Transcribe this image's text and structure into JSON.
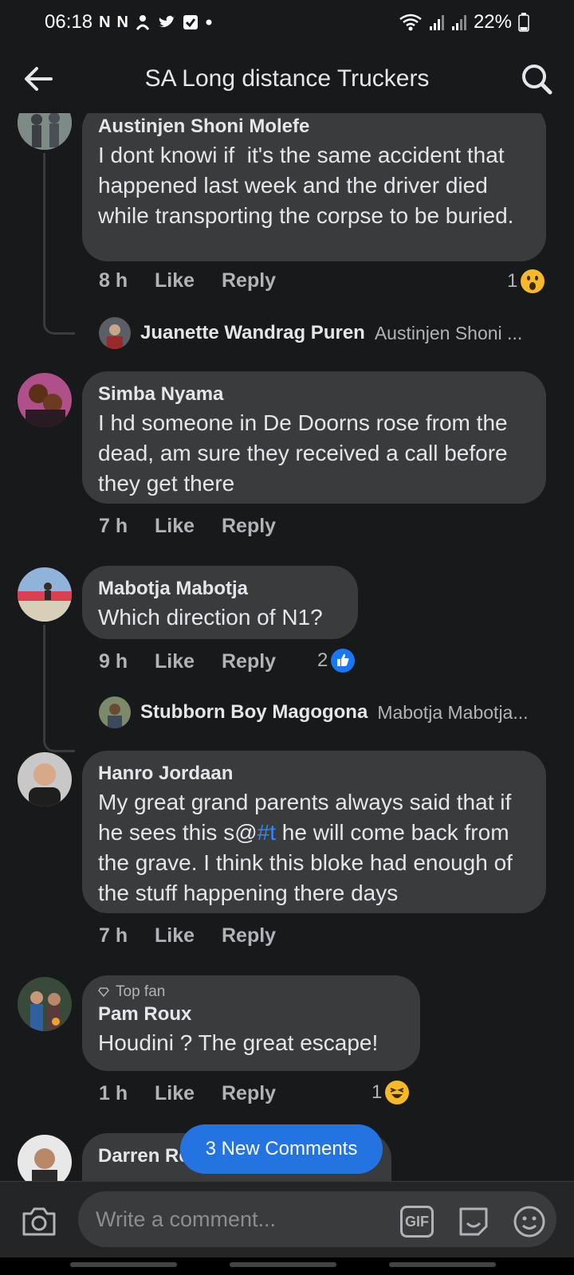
{
  "status_bar": {
    "time": "06:18",
    "battery": "22%",
    "notif_icons": [
      "N",
      "N"
    ]
  },
  "header": {
    "title": "SA Long distance Truckers"
  },
  "comments": [
    {
      "author": "Austinjen Shoni Molefe",
      "text": "I dont knowi if  it's the same accident that happened last week and the driver died while transporting the corpse to be buried.",
      "time": "8 h",
      "like": "Like",
      "reply": "Reply",
      "reaction_count": "1",
      "reaction": "wow",
      "reply_preview": {
        "author": "Juanette Wandrag Puren",
        "text": "Austinjen Shoni ..."
      }
    },
    {
      "author": "Simba Nyama",
      "text": "I hd someone in De Doorns rose from the dead, am sure they received a call before they get there",
      "time": "7 h",
      "like": "Like",
      "reply": "Reply"
    },
    {
      "author": "Mabotja Mabotja",
      "text": "Which direction of N1?",
      "time": "9 h",
      "like": "Like",
      "reply": "Reply",
      "reaction_count": "2",
      "reaction": "like",
      "reply_preview": {
        "author": "Stubborn Boy Magogona",
        "text": "Mabotja Mabotja..."
      }
    },
    {
      "author": "Hanro Jordaan",
      "text_before": "My great grand parents always said that if he sees this s@",
      "hashtag": "#t",
      "text_after": " he will come back from the grave. I think this bloke had enough of the stuff happening there days",
      "time": "7 h",
      "like": "Like",
      "reply": "Reply"
    },
    {
      "badge": "Top fan",
      "author": "Pam Roux",
      "text": "Houdini ? The great escape!",
      "time": "1 h",
      "like": "Like",
      "reply": "Reply",
      "reaction_count": "1",
      "reaction": "haha"
    },
    {
      "author": "Darren Reggy"
    }
  ],
  "new_comments_button": "3 New Comments",
  "composer": {
    "placeholder": "Write a comment...",
    "gif_label": "GIF"
  },
  "colors": {
    "background": "#18191a",
    "bubble": "#3a3b3c",
    "accent": "#2374e1",
    "hashtag": "#2d88ff",
    "muted": "#b0b3b8"
  }
}
